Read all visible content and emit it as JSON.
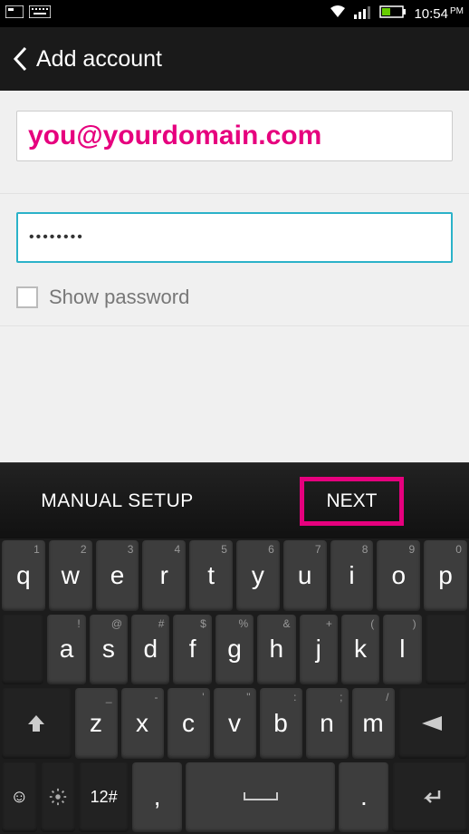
{
  "status": {
    "time": "10:54",
    "ampm": "PM"
  },
  "header": {
    "title": "Add account"
  },
  "form": {
    "email": "you@yourdomain.com",
    "password_masked": "••••••••",
    "show_password_label": "Show password"
  },
  "footer": {
    "manual": "MANUAL SETUP",
    "next": "NEXT"
  },
  "keyboard": {
    "row1": [
      {
        "main": "q",
        "sub": "1"
      },
      {
        "main": "w",
        "sub": "2"
      },
      {
        "main": "e",
        "sub": "3"
      },
      {
        "main": "r",
        "sub": "4"
      },
      {
        "main": "t",
        "sub": "5"
      },
      {
        "main": "y",
        "sub": "6"
      },
      {
        "main": "u",
        "sub": "7"
      },
      {
        "main": "i",
        "sub": "8"
      },
      {
        "main": "o",
        "sub": "9"
      },
      {
        "main": "p",
        "sub": "0"
      }
    ],
    "row2": [
      {
        "main": "a",
        "sub": "!"
      },
      {
        "main": "s",
        "sub": "@"
      },
      {
        "main": "d",
        "sub": "#"
      },
      {
        "main": "f",
        "sub": "$"
      },
      {
        "main": "g",
        "sub": "%"
      },
      {
        "main": "h",
        "sub": "&"
      },
      {
        "main": "j",
        "sub": "+"
      },
      {
        "main": "k",
        "sub": "("
      },
      {
        "main": "l",
        "sub": ")"
      }
    ],
    "row3": [
      {
        "main": "z",
        "sub": "_"
      },
      {
        "main": "x",
        "sub": "-"
      },
      {
        "main": "c",
        "sub": "'"
      },
      {
        "main": "v",
        "sub": "\""
      },
      {
        "main": "b",
        "sub": ":"
      },
      {
        "main": "n",
        "sub": ";"
      },
      {
        "main": "m",
        "sub": "/"
      }
    ],
    "row4": {
      "sym": "12#",
      "comma": ",",
      "period": "."
    }
  }
}
